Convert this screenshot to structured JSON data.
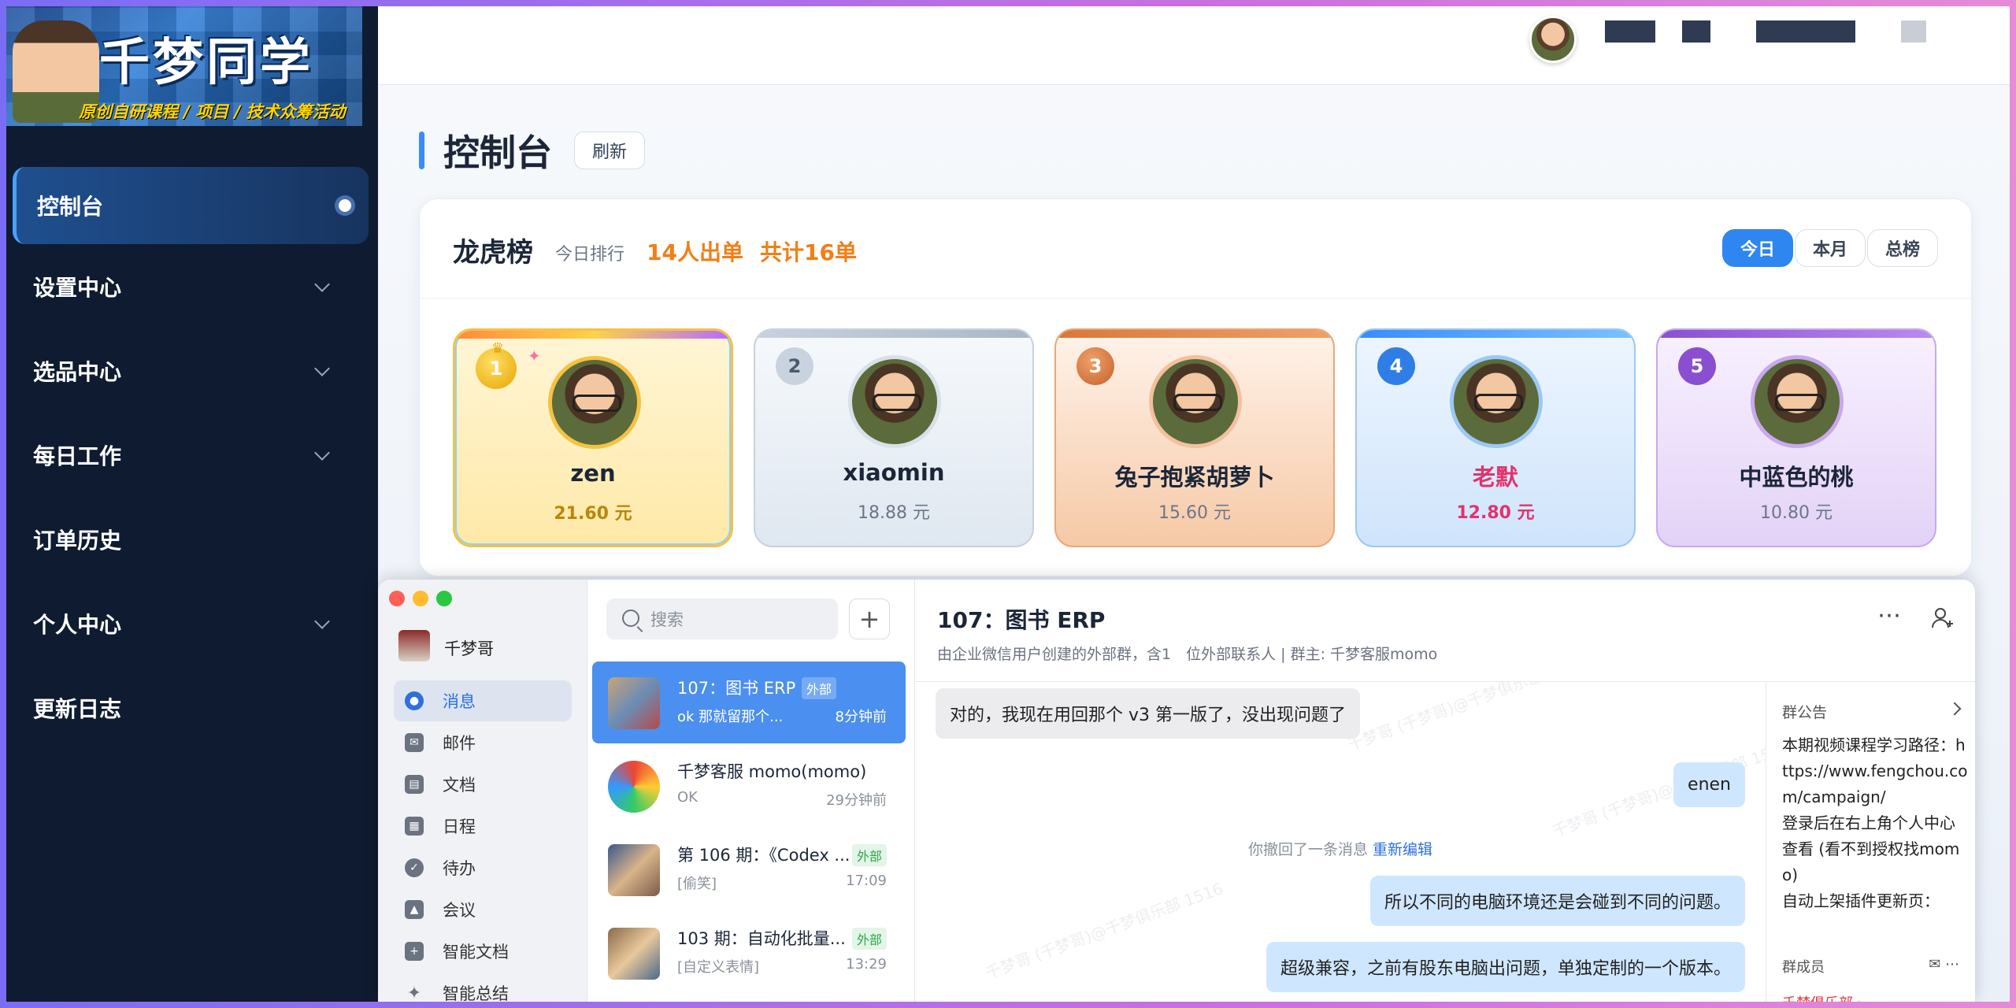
{
  "sidebar": {
    "logo_title": "千梦同学",
    "logo_sub": "原创自研课程 / 项目 / 技术众筹活动",
    "items": [
      {
        "label": "控制台",
        "active": true
      },
      {
        "label": "设置中心",
        "expandable": true
      },
      {
        "label": "选品中心",
        "expandable": true
      },
      {
        "label": "每日工作",
        "expandable": true
      },
      {
        "label": "订单历史"
      },
      {
        "label": "个人中心",
        "expandable": true
      },
      {
        "label": "更新日志"
      }
    ]
  },
  "page": {
    "title": "控制台",
    "refresh": "刷新"
  },
  "board": {
    "title": "龙虎榜",
    "subtitle": "今日排行",
    "stat_people": "14人出单",
    "stat_total": "共计16单",
    "tabs": [
      "今日",
      "本月",
      "总榜"
    ],
    "active_tab": "今日",
    "ranks": [
      {
        "rank": "1",
        "name": "zen",
        "amount": "21.60 元",
        "color": "#f0a800"
      },
      {
        "rank": "2",
        "name": "xiaomin",
        "amount": "18.88 元",
        "color": "#9aa7b7"
      },
      {
        "rank": "3",
        "name": "兔子抱紧胡萝卜",
        "amount": "15.60 元",
        "color": "#d97a3a"
      },
      {
        "rank": "4",
        "name": "老默",
        "amount": "12.80 元",
        "color": "#2f7ee6"
      },
      {
        "rank": "5",
        "name": "中蓝色的桃",
        "amount": "10.80 元",
        "color": "#8a4fd0"
      }
    ]
  },
  "chat": {
    "user": "千梦哥",
    "nav": [
      "消息",
      "邮件",
      "文档",
      "日程",
      "待办",
      "会议",
      "智能文档",
      "智能总结"
    ],
    "nav_icons": [
      "message-icon",
      "mail-icon",
      "doc-icon",
      "calendar-icon",
      "todo-icon",
      "meeting-icon",
      "smart-doc-icon",
      "sparkle-icon"
    ],
    "search_placeholder": "搜索",
    "list": [
      {
        "title": "107：图书 ERP",
        "tag": "外部",
        "preview": "ok  那就留那个...",
        "time": "8分钟前"
      },
      {
        "title": "千梦客服 momo(momo)",
        "tag": "",
        "preview": "OK",
        "time": "29分钟前"
      },
      {
        "title": "第 106 期：《Codex ...",
        "tag": "外部",
        "preview": "[偷笑]",
        "time": "17:09"
      },
      {
        "title": "103 期：自动化批量...",
        "tag": "外部",
        "preview": "[自定义表情]",
        "time": "13:29"
      }
    ],
    "conv_title": "107：图书 ERP",
    "conv_sub": "由企业微信用户创建的外部群，含1　位外部联系人 | 群主: 千梦客服momo",
    "messages": {
      "m1": "对的，我现在用回那个 v3 第一版了，没出现问题了",
      "m2": "enen",
      "sys": "你撤回了一条消息",
      "sys_link": "重新编辑",
      "m3": "所以不同的电脑环境还是会碰到不同的问题。",
      "m4": "超级兼容，之前有股东电脑出问题，单独定制的一个版本。"
    },
    "notice_title": "群公告",
    "notice_body": "本期视频课程学习路径：https://www.fengchou.com/campaign/\n登录后在右上角个人中心查看 (看不到授权找momo)\n自动上架插件更新页：",
    "members_label": "群成员",
    "footer_link": "千梦俱乐部 ›",
    "watermark": "千梦哥 (千梦哥)@千梦俱乐部 1516"
  }
}
